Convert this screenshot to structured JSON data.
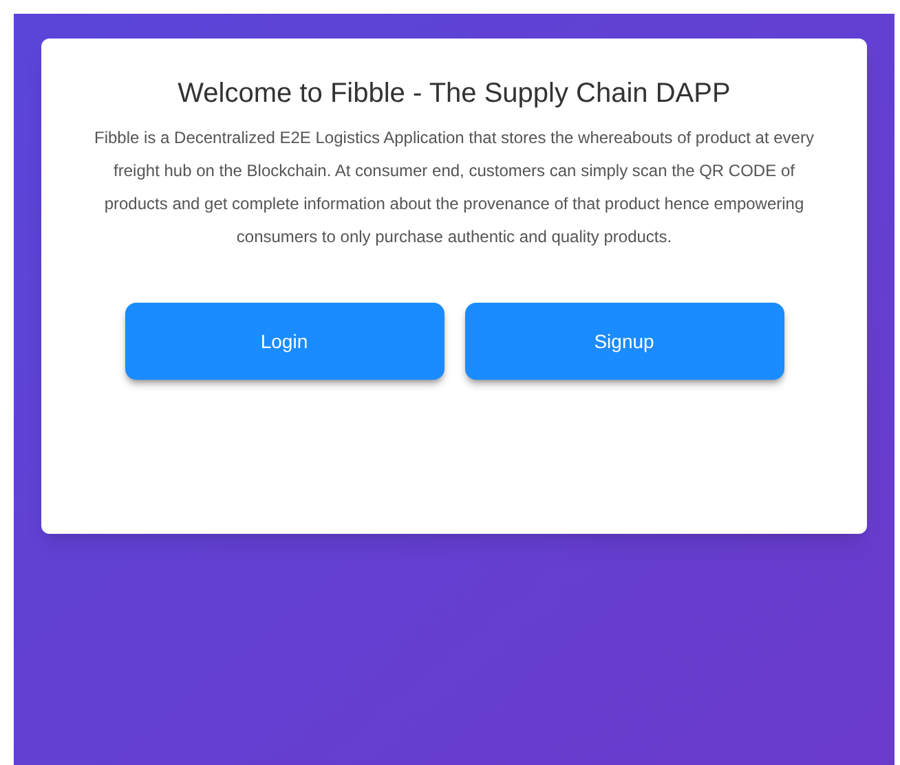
{
  "card": {
    "title": "Welcome to Fibble - The Supply Chain DAPP",
    "description": "Fibble is a Decentralized E2E Logistics Application that stores the whereabouts of product at every freight hub on the Blockchain. At consumer end, customers can simply scan the QR CODE of products and get complete information about the provenance of that product hence empowering consumers to only purchase authentic and quality products.",
    "buttons": [
      "Login",
      "Signup"
    ]
  }
}
